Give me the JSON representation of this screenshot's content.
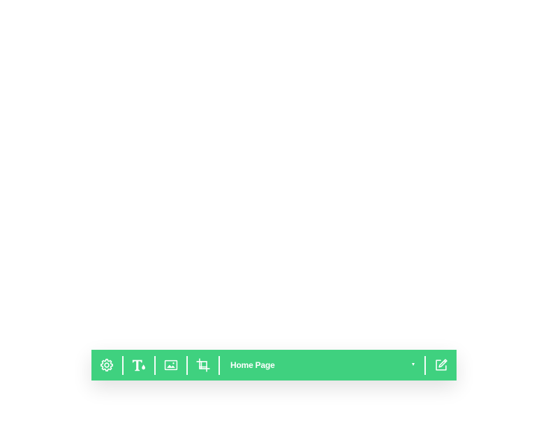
{
  "toolbar": {
    "accent_color": "#3fd17f",
    "buttons": [
      {
        "name": "settings",
        "icon": "gear-icon"
      },
      {
        "name": "typography",
        "icon": "text-color-icon"
      },
      {
        "name": "image",
        "icon": "image-icon"
      },
      {
        "name": "crop",
        "icon": "crop-icon"
      },
      {
        "name": "edit",
        "icon": "edit-icon"
      }
    ],
    "page_select": {
      "selected": "Home Page",
      "icon": "chevron-down-icon"
    }
  }
}
